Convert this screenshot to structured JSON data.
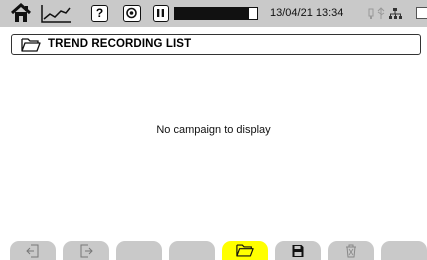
{
  "status_bar": {
    "datetime": "13/04/21 13:34",
    "recording_progress": 0.9,
    "icons": [
      "home-icon",
      "trend-icon",
      "help-icon",
      "snapshot-icon",
      "pause-icon",
      "usb-icon",
      "network-icon",
      "battery-icon"
    ]
  },
  "window": {
    "title": "TREND RECORDING LIST",
    "icon": "folder-open-icon"
  },
  "content": {
    "empty_message": "No campaign to display"
  },
  "softkeys": [
    {
      "name": "import-softkey",
      "icon": "import-icon",
      "active": false
    },
    {
      "name": "export-softkey",
      "icon": "export-icon",
      "active": false
    },
    {
      "name": "softkey-3",
      "icon": "",
      "active": false
    },
    {
      "name": "softkey-4",
      "icon": "",
      "active": false
    },
    {
      "name": "open-folder-softkey",
      "icon": "folder-open-icon",
      "active": true
    },
    {
      "name": "save-softkey",
      "icon": "floppy-disk-icon",
      "active": false
    },
    {
      "name": "delete-softkey",
      "icon": "trash-icon",
      "active": false
    },
    {
      "name": "softkey-8",
      "icon": "",
      "active": false
    }
  ],
  "colors": {
    "bar_gray": "#c9c9c9",
    "active_yellow": "#ffff00"
  }
}
